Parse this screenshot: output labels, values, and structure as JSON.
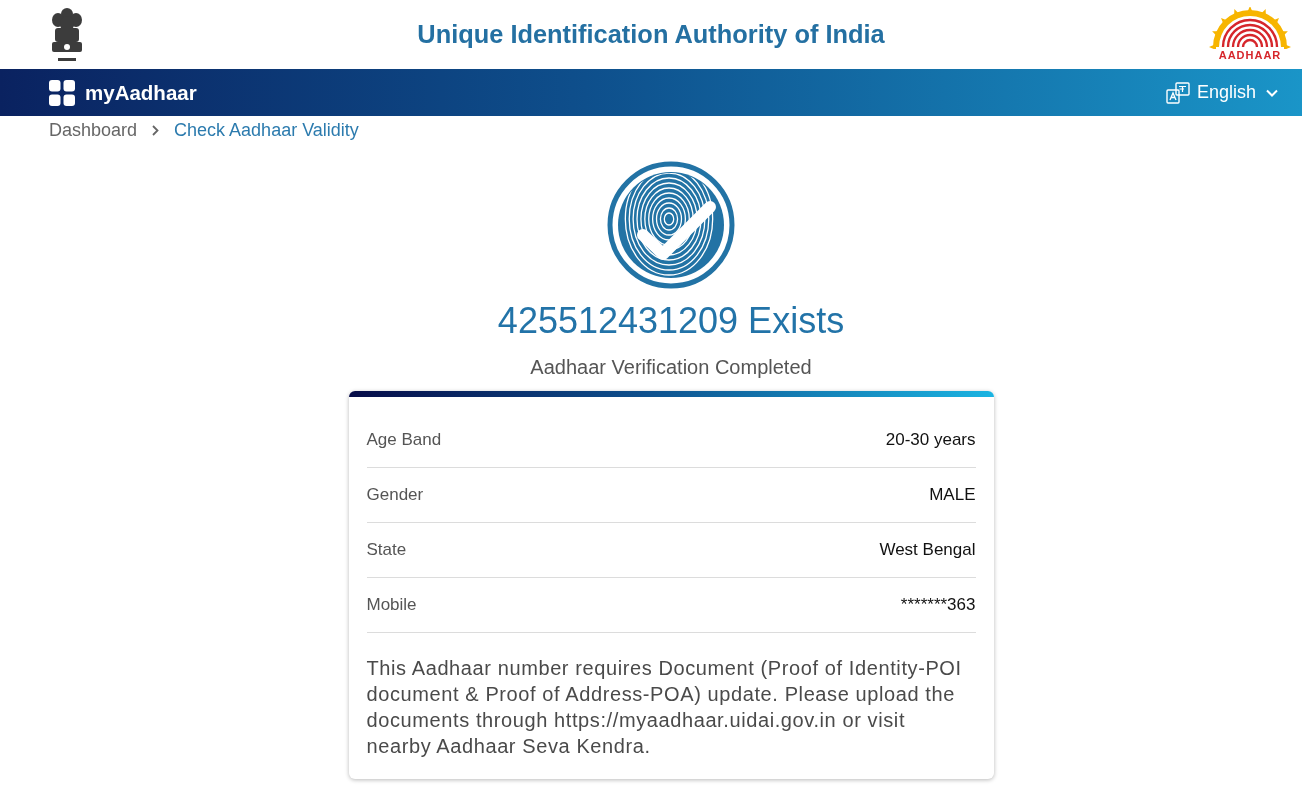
{
  "header": {
    "title": "Unique Identification Authority of India",
    "logo_text": "AADHAAR"
  },
  "navbar": {
    "brand": "myAadhaar",
    "language": "English"
  },
  "breadcrumb": [
    {
      "label": "Dashboard",
      "current": false
    },
    {
      "label": "Check Aadhaar Validity",
      "current": true
    }
  ],
  "result": {
    "heading": "425512431209 Exists",
    "subtitle": "Aadhaar Verification Completed"
  },
  "details": {
    "rows": [
      {
        "label": "Age Band",
        "value": "20-30 years"
      },
      {
        "label": "Gender",
        "value": "MALE"
      },
      {
        "label": "State",
        "value": "West Bengal"
      },
      {
        "label": "Mobile",
        "value": "*******363"
      }
    ],
    "note": "This Aadhaar number requires Document (Proof of Identity-POI document & Proof of Address-POA) update. Please upload the documents through https://myaadhaar.uidai.gov.in or visit nearby Aadhaar Seva Kendra."
  }
}
